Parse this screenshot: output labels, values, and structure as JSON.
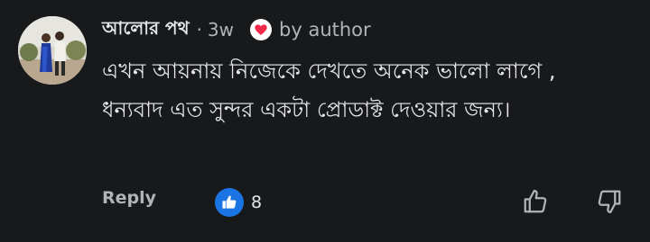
{
  "comment": {
    "author": "আলোর পথ",
    "separator": "·",
    "time": "3w",
    "badge_label": "by author",
    "text": "এখন আয়নায় নিজেকে দেখতে অনেক ভালো লাগে , ধন্যবাদ এত সুন্দর একটা প্রোডাক্ট দেওয়ার জন্য।",
    "reply_label": "Reply",
    "like_count": "8"
  },
  "icons": {
    "heart": "heart-icon",
    "like": "thumbs-up-icon",
    "thumb_up": "thumbs-up-outline-icon",
    "thumb_down": "thumbs-down-outline-icon"
  },
  "colors": {
    "background": "#18191a",
    "heart": "#f02849",
    "like_badge": "#1b74e4",
    "text": "#e4e6eb",
    "muted": "#b0b3b8"
  }
}
